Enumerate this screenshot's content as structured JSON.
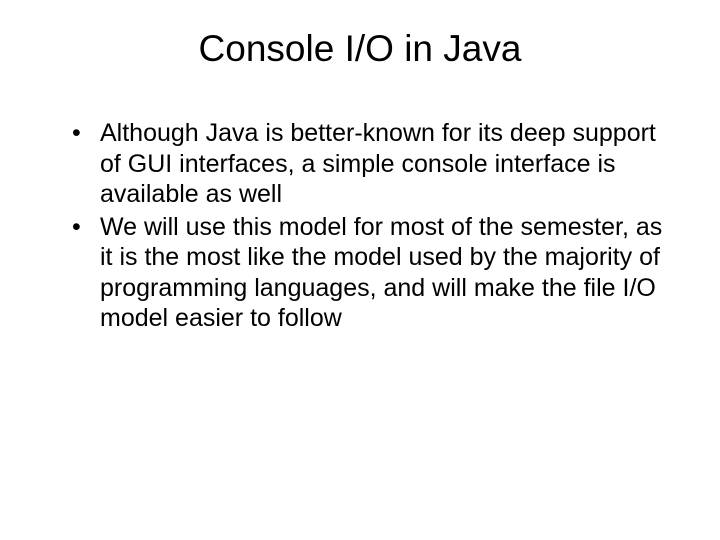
{
  "slide": {
    "title": "Console I/O in Java",
    "bullets": [
      "Although Java is better-known for its deep support of GUI interfaces, a simple console interface is available as well",
      "We will use this model for most of the semester, as it is the most like the model used by the majority of programming languages, and will make the file I/O model easier to follow"
    ]
  }
}
